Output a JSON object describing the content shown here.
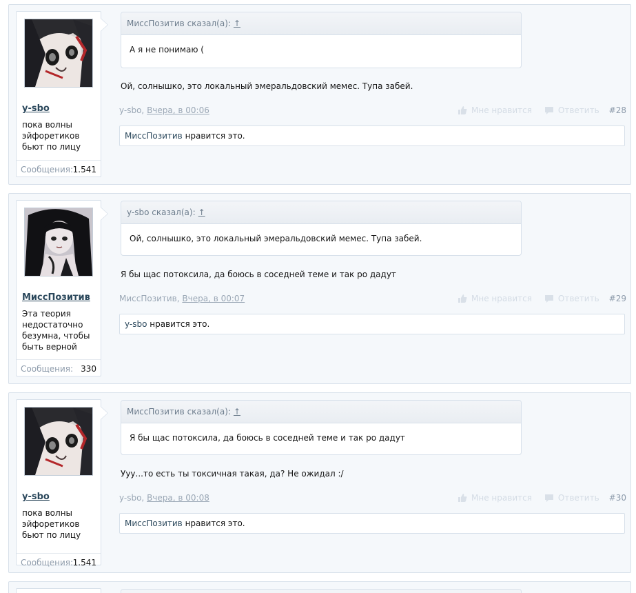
{
  "posts": [
    {
      "user": {
        "name": "y-sbo",
        "title": "пока волны эйфоретиков бьют по лицу",
        "stats_label": "Сообщения:",
        "stats_value": "1.541",
        "avatar": "anime-girl-avatar-dark"
      },
      "quote": {
        "author_line": "МиссПозитив сказал(а):",
        "arrow": "↑",
        "text": "А я не понимаю ("
      },
      "message": "Ой, солнышко, это локальный эмеральдовский мемес. Тупа забей.",
      "meta": {
        "author": "y-sbo,",
        "date": "Вчера, в 00:06",
        "like_label": "Мне нравится",
        "reply_label": "Ответить",
        "number": "#28"
      },
      "likes": {
        "liker": "МиссПозитив",
        "text": " нравится это."
      }
    },
    {
      "user": {
        "name": "МиссПозитив",
        "title": "Эта теория недостаточно безумна, чтобы быть верной",
        "stats_label": "Сообщения:",
        "stats_value": "330",
        "avatar": "anime-girl-avatar-black-hair"
      },
      "quote": {
        "author_line": "y-sbo сказал(а):",
        "arrow": "↑",
        "text": "Ой, солнышко, это локальный эмеральдовский мемес. Тупа забей."
      },
      "message": "Я бы щас потоксила, да боюсь в соседней теме и так ро дадут",
      "meta": {
        "author": "МиссПозитив,",
        "date": "Вчера, в 00:07",
        "like_label": "Мне нравится",
        "reply_label": "Ответить",
        "number": "#29"
      },
      "likes": {
        "liker": "y-sbo",
        "text": " нравится это."
      }
    },
    {
      "user": {
        "name": "y-sbo",
        "title": "пока волны эйфоретиков бьют по лицу",
        "stats_label": "Сообщения:",
        "stats_value": "1.541",
        "avatar": "anime-girl-avatar-dark"
      },
      "quote": {
        "author_line": "МиссПозитив сказал(а):",
        "arrow": "↑",
        "text": "Я бы щас потоксила, да боюсь в соседней теме и так ро дадут"
      },
      "message": "Ууу...то есть ты токсичная такая, да? Не ожидал :/",
      "meta": {
        "author": "y-sbo,",
        "date": "Вчера, в 00:08",
        "like_label": "Мне нравится",
        "reply_label": "Ответить",
        "number": "#30"
      },
      "likes": {
        "liker": "МиссПозитив",
        "text": " нравится это."
      }
    }
  ],
  "colors": {
    "link": "#2b485c",
    "muted": "#9aa7b5",
    "border": "#d7e0ea",
    "post_bg": "#f5f8fb"
  }
}
